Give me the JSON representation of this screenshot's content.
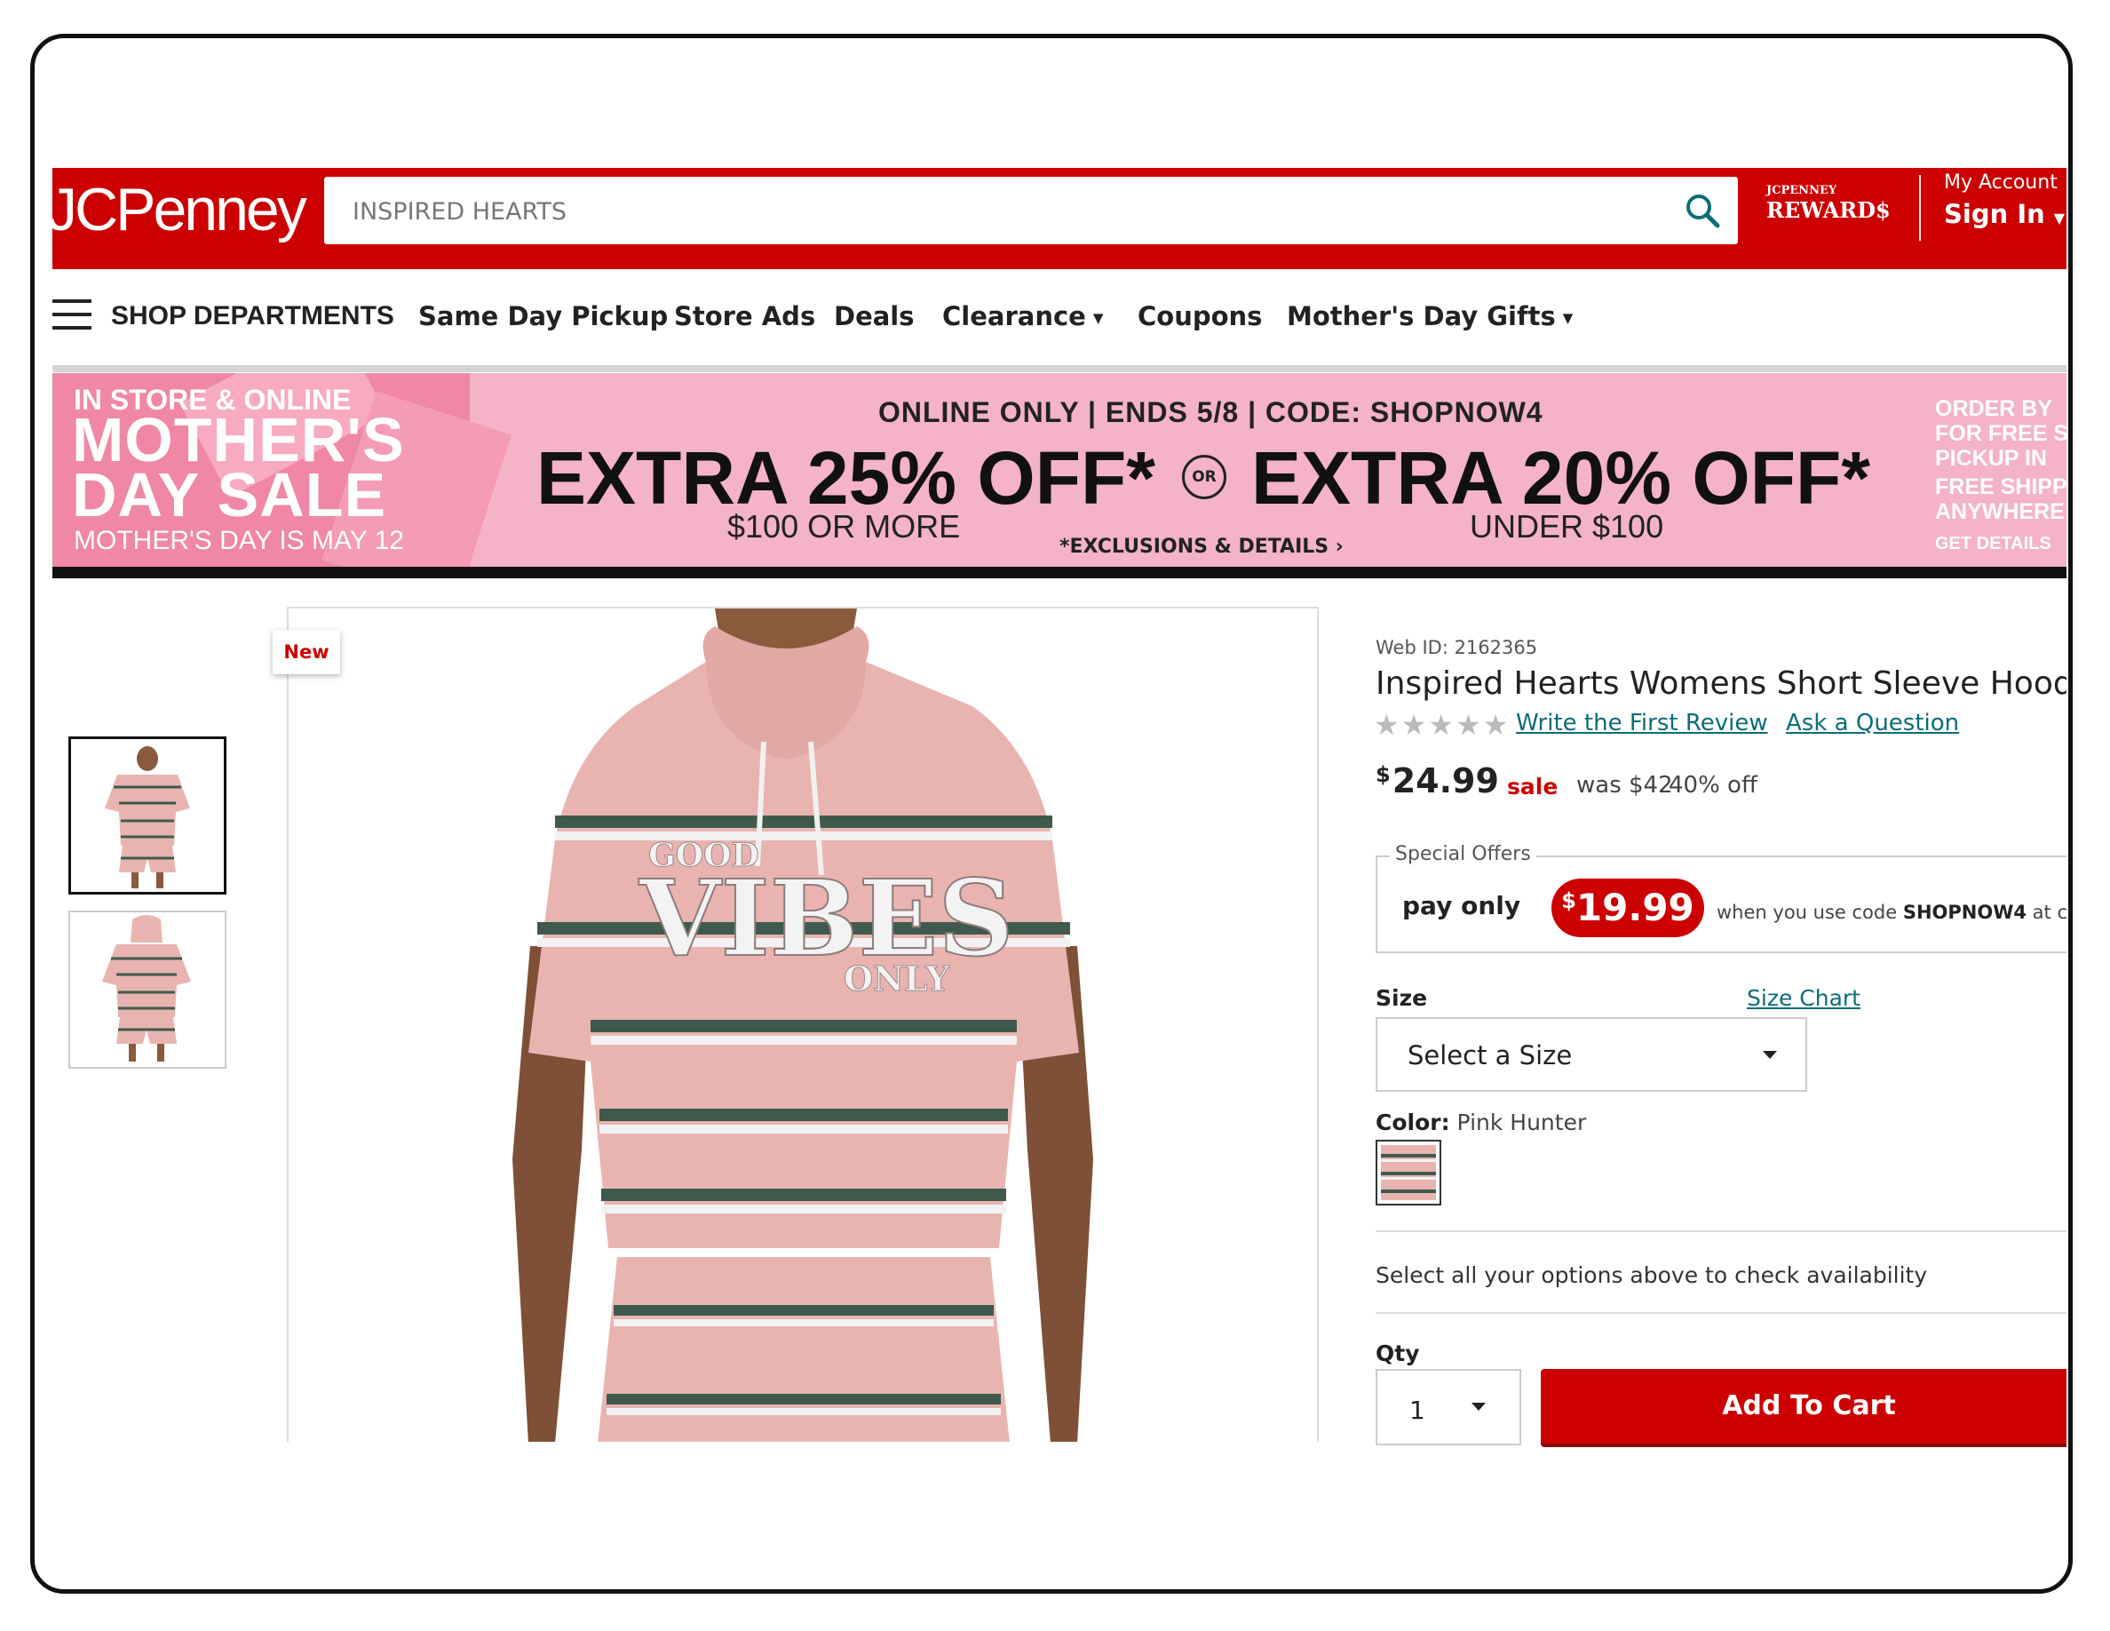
{
  "header": {
    "logo_text": "JCPenney",
    "search_value": "INSPIRED HEARTS",
    "rewards_small": "JCPENNEY",
    "rewards_big": "REWARD$",
    "account_line1": "My Account",
    "account_line2": "Sign In"
  },
  "nav": {
    "shop_departments": "SHOP DEPARTMENTS",
    "items": [
      "Same Day Pickup",
      "Store Ads",
      "Deals",
      "Clearance",
      "Coupons",
      "Mother's Day Gifts"
    ]
  },
  "banner": {
    "left_line1": "IN STORE & ONLINE",
    "left_line2": "MOTHER'S",
    "left_line3": "DAY SALE",
    "left_line4": "MOTHER'S DAY IS MAY 12",
    "top_line": "ONLINE ONLY | ENDS 5/8 | CODE: SHOPNOW4",
    "offer1": "EXTRA 25% OFF*",
    "or": "OR",
    "offer2": "EXTRA 20% OFF*",
    "sub1": "$100 OR MORE",
    "exclusions": "*EXCLUSIONS & DETAILS ›",
    "sub2": "UNDER $100",
    "right_line1": "ORDER BY",
    "right_line2": "FOR FREE S",
    "right_line3": "PICKUP IN",
    "right_line4": "FREE SHIPP",
    "right_line5": "ANYWHERE",
    "right_line6": "GET DETAILS"
  },
  "product": {
    "badge": "New",
    "web_id": "Web ID: 2162365",
    "title": "Inspired Hearts Womens Short Sleeve Hoodie",
    "stars": "★★★★★",
    "write_review": "Write the First Review",
    "ask_question": "Ask a Question",
    "price_symbol": "$",
    "price": "24.99",
    "sale_label": "sale",
    "was": "was $42",
    "off": "40% off",
    "special_offers_label": "Special Offers",
    "pay_only": "pay only",
    "special_symbol": "$",
    "special_price": "19.99",
    "when_use_prefix": "when you use code",
    "code": "SHOPNOW4",
    "when_use_suffix": "at checkout",
    "size_label": "Size",
    "size_chart": "Size Chart",
    "size_placeholder": "Select a Size",
    "color_label": "Color:",
    "color_value": "Pink Hunter",
    "availability": "Select all your options above to check availability",
    "qty_label": "Qty",
    "qty_value": "1",
    "add_to_cart": "Add To Cart",
    "garment_text_1": "GOOD",
    "garment_text_2": "VIBES",
    "garment_text_3": "ONLY"
  },
  "colors": {
    "brand_red": "#cc0000",
    "banner_pink": "#f4b3c7",
    "link_teal": "#0b6d77",
    "shirt_pink": "#e9b4b0",
    "stripe_green": "#3f5a4c"
  }
}
